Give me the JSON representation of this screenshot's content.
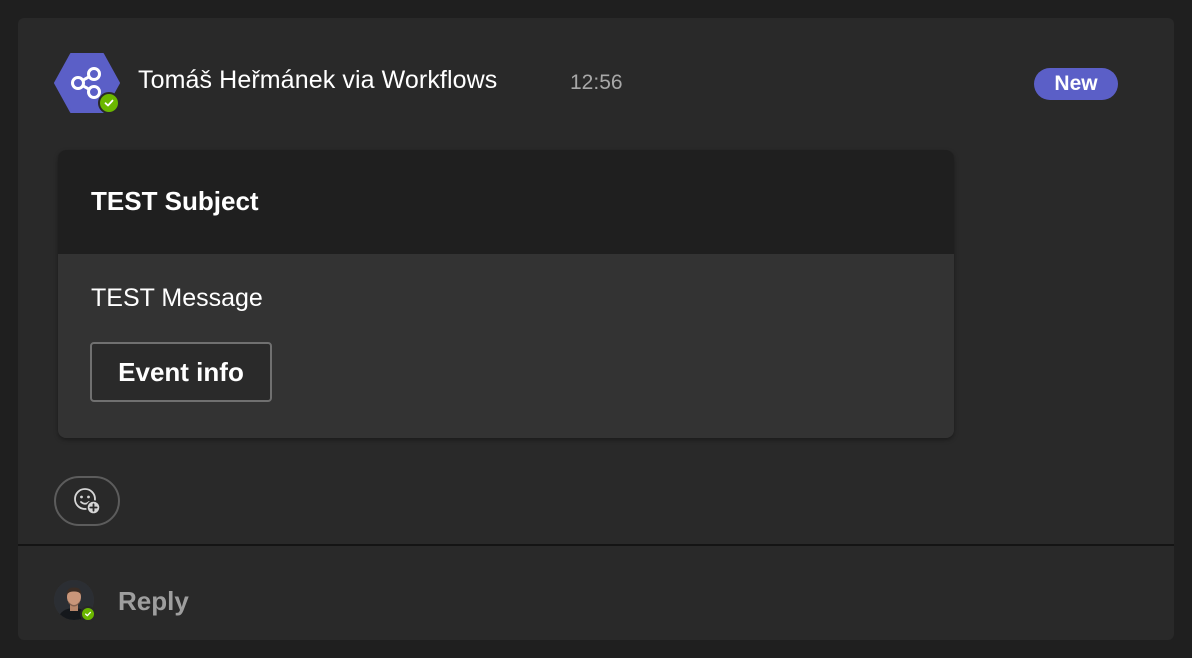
{
  "post": {
    "sender": "Tomáš Heřmánek via Workflows",
    "time": "12:56",
    "badge": "New",
    "app_icon": "workflows-share-icon",
    "presence_icon": "available-check-icon",
    "colors": {
      "badge_bg": "#5b5fc7",
      "app_icon_bg": "#5b5fc7",
      "presence": "#6bb700"
    }
  },
  "card": {
    "title": "TEST Subject",
    "message": "TEST Message",
    "button_label": "Event info"
  },
  "reaction": {
    "icon": "add-reaction-emoji-icon"
  },
  "reply": {
    "label": "Reply",
    "avatar_icon": "user-avatar"
  }
}
